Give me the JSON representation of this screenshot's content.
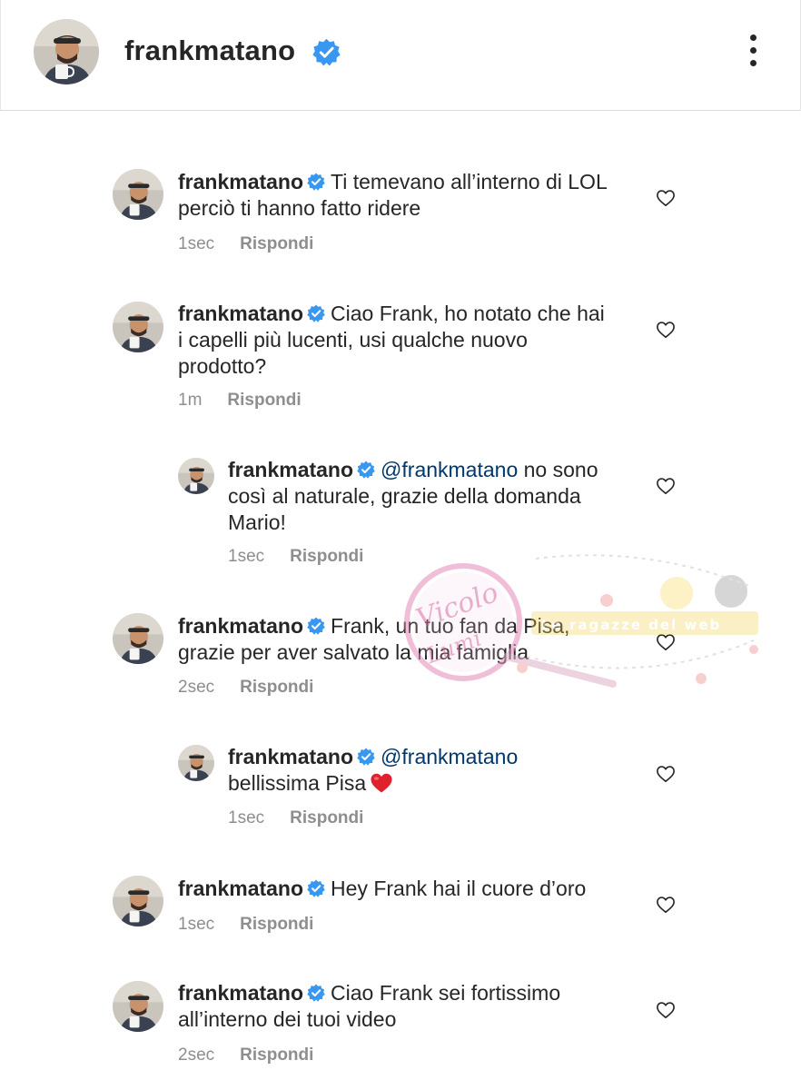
{
  "header": {
    "username": "frankmatano",
    "verified_icon": "verified-badge-icon",
    "menu_icon": "kebab-menu-icon"
  },
  "colors": {
    "verified": "#3897f0",
    "mention": "#00376b",
    "meta": "#8e8e8e",
    "emoji_heart": "#e0202a"
  },
  "comments": [
    {
      "username": "frankmatano",
      "text": "Ti temevano all’interno di LOL perciò ti hanno fatto ridere",
      "time": "1sec",
      "reply_label": "Rispondi"
    },
    {
      "username": "frankmatano",
      "text": "Ciao Frank, ho notato che hai i capelli più lucenti, usi qualche nuovo prodotto?",
      "time": "1m",
      "reply_label": "Rispondi"
    },
    {
      "username": "frankmatano",
      "mention": "@frankmatano",
      "text": "no sono così al naturale, grazie della domanda Mario!",
      "time": "1sec",
      "reply_label": "Rispondi"
    },
    {
      "username": "frankmatano",
      "text": "Frank, un tuo fan da Pisa, grazie per aver salvato la mia famiglia",
      "time": "2sec",
      "reply_label": "Rispondi"
    },
    {
      "username": "frankmatano",
      "mention": "@frankmatano",
      "text": "bellissima Pisa",
      "emoji": "red-heart-emoji",
      "time": "1sec",
      "reply_label": "Rispondi"
    },
    {
      "username": "frankmatano",
      "text": "Hey Frank hai il cuore d’oro",
      "time": "1sec",
      "reply_label": "Rispondi"
    },
    {
      "username": "frankmatano",
      "text": "Ciao Frank sei fortissimo all’interno dei tuoi video",
      "time": "2sec",
      "reply_label": "Rispondi"
    }
  ],
  "watermark": {
    "signature": "Vicolo Lumì",
    "banner": "Le ragazze del web"
  }
}
